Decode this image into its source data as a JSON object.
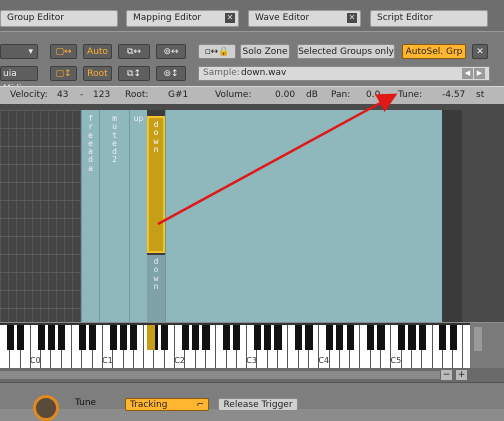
{
  "tabs": [
    {
      "label": "Group Editor",
      "close": false
    },
    {
      "label": "Mapping Editor",
      "close": true
    },
    {
      "label": "Wave Editor",
      "close": true
    },
    {
      "label": "Script Editor",
      "close": false
    }
  ],
  "toolbar": {
    "left_label": "uia Midi",
    "auto_label": "Auto",
    "root_label": "Root",
    "solo_zone": "Solo Zone",
    "selected_groups_only": "Selected Groups only",
    "autosel_grp": "AutoSel. Grp",
    "sample_label": "Sample:",
    "sample_value": "down.wav",
    "close_x": "✕"
  },
  "params": {
    "velocity_label": "Velocity:",
    "velocity_low": "43",
    "velocity_dash": "-",
    "velocity_high": "123",
    "root_label": "Root:",
    "root_value": "G#1",
    "volume_label": "Volume:",
    "volume_value": "0.00",
    "volume_unit": "dB",
    "pan_label": "Pan:",
    "pan_value": "0.0",
    "tune_label": "Tune:",
    "tune_value": "-4.57",
    "tune_unit": "st"
  },
  "zones": {
    "left_col1": "freeada",
    "left_col2": "muted2",
    "up": "up",
    "selected_top": "down",
    "selected_bottom": "down"
  },
  "keyboard": {
    "octaves": [
      "C0",
      "C1",
      "C2",
      "C3",
      "C4",
      "C5"
    ]
  },
  "bottom": {
    "tune_label": "Tune",
    "tracking": "Tracking",
    "release_trigger": "Release Trigger"
  },
  "colors": {
    "accent": "#ffb52e",
    "zone": "#8fb8bd",
    "arrow": "#e01818"
  }
}
